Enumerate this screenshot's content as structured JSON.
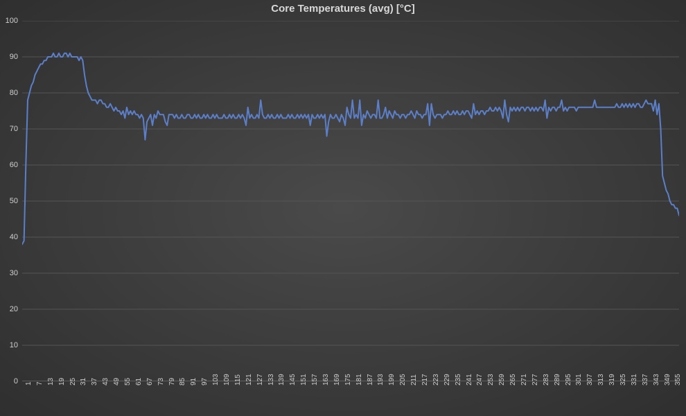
{
  "chart_data": {
    "type": "line",
    "title": "Core Temperatures (avg) [°C]",
    "ylabel": "",
    "xlabel": "",
    "ylim": [
      0,
      100
    ],
    "y_ticks": [
      0,
      10,
      20,
      30,
      40,
      50,
      60,
      70,
      80,
      90,
      100
    ],
    "x_tick_labels": [
      1,
      7,
      13,
      19,
      25,
      31,
      37,
      43,
      49,
      55,
      61,
      67,
      73,
      79,
      85,
      91,
      97,
      103,
      109,
      115,
      121,
      127,
      133,
      139,
      145,
      151,
      157,
      163,
      169,
      175,
      181,
      187,
      193,
      199,
      205,
      211,
      217,
      223,
      229,
      235,
      241,
      247,
      253,
      259,
      265,
      271,
      277,
      283,
      289,
      295,
      301,
      307,
      313,
      319,
      325,
      331,
      337,
      343,
      349,
      355
    ],
    "x": [
      1,
      2,
      3,
      4,
      5,
      6,
      7,
      8,
      9,
      10,
      11,
      12,
      13,
      14,
      15,
      16,
      17,
      18,
      19,
      20,
      21,
      22,
      23,
      24,
      25,
      26,
      27,
      28,
      29,
      30,
      31,
      32,
      33,
      34,
      35,
      36,
      37,
      38,
      39,
      40,
      41,
      42,
      43,
      44,
      45,
      46,
      47,
      48,
      49,
      50,
      51,
      52,
      53,
      54,
      55,
      56,
      57,
      58,
      59,
      60,
      61,
      62,
      63,
      64,
      65,
      66,
      67,
      68,
      69,
      70,
      71,
      72,
      73,
      74,
      75,
      76,
      77,
      78,
      79,
      80,
      81,
      82,
      83,
      84,
      85,
      86,
      87,
      88,
      89,
      90,
      91,
      92,
      93,
      94,
      95,
      96,
      97,
      98,
      99,
      100,
      101,
      102,
      103,
      104,
      105,
      106,
      107,
      108,
      109,
      110,
      111,
      112,
      113,
      114,
      115,
      116,
      117,
      118,
      119,
      120,
      121,
      122,
      123,
      124,
      125,
      126,
      127,
      128,
      129,
      130,
      131,
      132,
      133,
      134,
      135,
      136,
      137,
      138,
      139,
      140,
      141,
      142,
      143,
      144,
      145,
      146,
      147,
      148,
      149,
      150,
      151,
      152,
      153,
      154,
      155,
      156,
      157,
      158,
      159,
      160,
      161,
      162,
      163,
      164,
      165,
      166,
      167,
      168,
      169,
      170,
      171,
      172,
      173,
      174,
      175,
      176,
      177,
      178,
      179,
      180,
      181,
      182,
      183,
      184,
      185,
      186,
      187,
      188,
      189,
      190,
      191,
      192,
      193,
      194,
      195,
      196,
      197,
      198,
      199,
      200,
      201,
      202,
      203,
      204,
      205,
      206,
      207,
      208,
      209,
      210,
      211,
      212,
      213,
      214,
      215,
      216,
      217,
      218,
      219,
      220,
      221,
      222,
      223,
      224,
      225,
      226,
      227,
      228,
      229,
      230,
      231,
      232,
      233,
      234,
      235,
      236,
      237,
      238,
      239,
      240,
      241,
      242,
      243,
      244,
      245,
      246,
      247,
      248,
      249,
      250,
      251,
      252,
      253,
      254,
      255,
      256,
      257,
      258,
      259,
      260,
      261,
      262,
      263,
      264,
      265,
      266,
      267,
      268,
      269,
      270,
      271,
      272,
      273,
      274,
      275,
      276,
      277,
      278,
      279,
      280,
      281,
      282,
      283,
      284,
      285,
      286,
      287,
      288,
      289,
      290,
      291,
      292,
      293,
      294,
      295,
      296,
      297,
      298,
      299,
      300,
      301,
      302,
      303,
      304,
      305,
      306,
      307,
      308,
      309,
      310,
      311,
      312,
      313,
      314,
      315,
      316,
      317,
      318,
      319,
      320,
      321,
      322,
      323,
      324,
      325,
      326,
      327,
      328,
      329,
      330,
      331,
      332,
      333,
      334,
      335,
      336,
      337,
      338,
      339,
      340,
      341,
      342,
      343,
      344,
      345,
      346,
      347,
      348,
      349,
      350,
      351,
      352,
      353,
      354,
      355,
      356,
      357,
      358,
      359
    ],
    "values": [
      38,
      39,
      60,
      78,
      80,
      82,
      83,
      85,
      86,
      87,
      88,
      88,
      89,
      89,
      90,
      90,
      90,
      91,
      90,
      90,
      91,
      90,
      90,
      91,
      91,
      90,
      91,
      90,
      90,
      90,
      90,
      89,
      90,
      89,
      85,
      82,
      80,
      79,
      78,
      78,
      78,
      77,
      78,
      78,
      77,
      77,
      76,
      76,
      77,
      76,
      75,
      76,
      75,
      75,
      74,
      75,
      73,
      76,
      74,
      75,
      74,
      75,
      74,
      74,
      73,
      74,
      73,
      67,
      72,
      73,
      74,
      71,
      74,
      73,
      75,
      74,
      74,
      74,
      72,
      71,
      74,
      74,
      74,
      73,
      74,
      73,
      73,
      74,
      73,
      73,
      74,
      74,
      73,
      73,
      74,
      73,
      74,
      73,
      73,
      74,
      73,
      74,
      73,
      73,
      74,
      73,
      74,
      73,
      73,
      73,
      74,
      73,
      73,
      74,
      73,
      74,
      73,
      73,
      74,
      73,
      74,
      73,
      71,
      76,
      73,
      74,
      73,
      73,
      74,
      73,
      78,
      74,
      73,
      73,
      74,
      73,
      74,
      73,
      73,
      74,
      73,
      74,
      73,
      73,
      73,
      74,
      73,
      74,
      73,
      73,
      74,
      73,
      74,
      73,
      74,
      73,
      74,
      71,
      74,
      73,
      73,
      74,
      73,
      74,
      73,
      74,
      68,
      72,
      74,
      73,
      73,
      74,
      73,
      72,
      74,
      73,
      71,
      76,
      74,
      73,
      78,
      73,
      74,
      73,
      78,
      71,
      74,
      73,
      75,
      74,
      73,
      74,
      74,
      73,
      78,
      73,
      73,
      74,
      76,
      73,
      75,
      74,
      73,
      75,
      74,
      74,
      73,
      74,
      74,
      73,
      74,
      74,
      75,
      74,
      73,
      75,
      74,
      74,
      73,
      74,
      74,
      77,
      71,
      77,
      74,
      73,
      74,
      74,
      74,
      73,
      74,
      74,
      75,
      74,
      74,
      75,
      74,
      75,
      74,
      74,
      75,
      74,
      75,
      75,
      74,
      73,
      77,
      74,
      75,
      74,
      75,
      75,
      74,
      75,
      75,
      76,
      75,
      75,
      76,
      75,
      76,
      75,
      73,
      78,
      74,
      72,
      76,
      75,
      76,
      75,
      76,
      75,
      76,
      76,
      75,
      76,
      76,
      75,
      76,
      75,
      76,
      75,
      76,
      76,
      75,
      78,
      73,
      76,
      75,
      76,
      76,
      75,
      76,
      76,
      78,
      75,
      76,
      75,
      76,
      76,
      76,
      76,
      75,
      76,
      76,
      76,
      76,
      76,
      76,
      76,
      76,
      76,
      78,
      76,
      76,
      76,
      76,
      76,
      76,
      76,
      76,
      76,
      76,
      76,
      77,
      76,
      76,
      77,
      76,
      77,
      76,
      77,
      76,
      77,
      76,
      77,
      77,
      76,
      76,
      77,
      78,
      77,
      77,
      77,
      75,
      78,
      74,
      77,
      70,
      57,
      55,
      53,
      52,
      50,
      49,
      49,
      48,
      48,
      46
    ],
    "series_color": "#5c7fc9"
  }
}
